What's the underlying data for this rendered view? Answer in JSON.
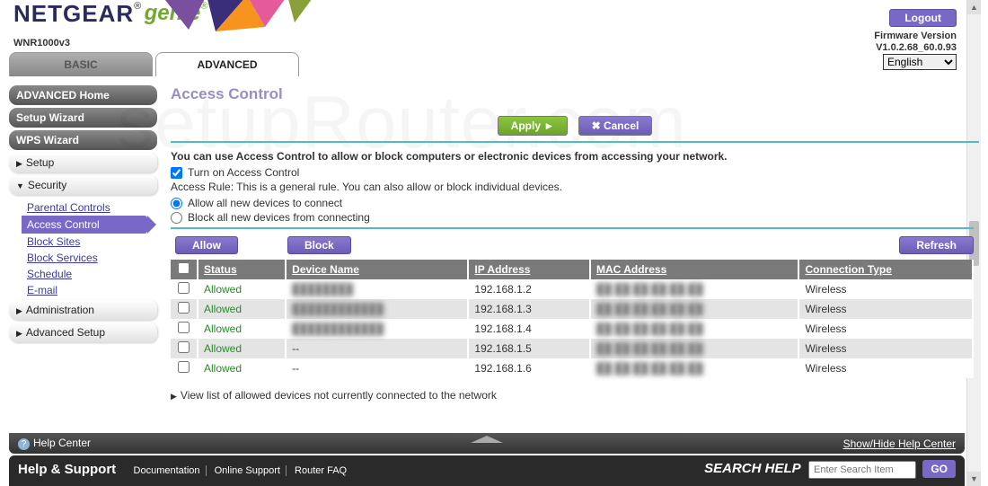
{
  "brand": {
    "netgear": "NETGEAR",
    "genie": "genie",
    "reg": "®"
  },
  "model": "WNR1000v3",
  "logout": "Logout",
  "firmware": {
    "label": "Firmware Version",
    "version": "V1.0.2.68_60.0.93"
  },
  "language": {
    "selected": "English"
  },
  "tabs": {
    "basic": "BASIC",
    "advanced": "ADVANCED"
  },
  "sidebar": {
    "home": "ADVANCED Home",
    "setup_wizard": "Setup Wizard",
    "wps_wizard": "WPS Wizard",
    "setup": "Setup",
    "security": "Security",
    "security_items": {
      "parental": "Parental Controls",
      "access_control": "Access Control",
      "block_sites": "Block Sites",
      "block_services": "Block Services",
      "schedule": "Schedule",
      "email": "E-mail"
    },
    "administration": "Administration",
    "advanced_setup": "Advanced Setup"
  },
  "page": {
    "title": "Access Control",
    "apply": "Apply ►",
    "cancel": "Cancel",
    "cancel_x": "✖",
    "intro": "You can use Access Control to allow or block computers or electronic devices from accessing your network.",
    "turn_on": "Turn on Access Control",
    "rule_text": "Access Rule: This is a general rule. You can also allow or block individual devices.",
    "radio_allow": "Allow all new devices to connect",
    "radio_block": "Block all new devices from connecting",
    "allow_btn": "Allow",
    "block_btn": "Block",
    "refresh_btn": "Refresh",
    "cols": {
      "status": "Status",
      "device": "Device Name",
      "ip": "IP Address",
      "mac": "MAC Address",
      "conn": "Connection Type"
    },
    "rows": [
      {
        "status": "Allowed",
        "device": "████████",
        "ip": "192.168.1.2",
        "mac": "██:██:██:██:██:██",
        "conn": "Wireless"
      },
      {
        "status": "Allowed",
        "device": "████████████",
        "ip": "192.168.1.3",
        "mac": "██:██:██:██:██:██",
        "conn": "Wireless"
      },
      {
        "status": "Allowed",
        "device": "████████████",
        "ip": "192.168.1.4",
        "mac": "██:██:██:██:██:██",
        "conn": "Wireless"
      },
      {
        "status": "Allowed",
        "device": "--",
        "ip": "192.168.1.5",
        "mac": "██:██:██:██:██:██",
        "conn": "Wireless"
      },
      {
        "status": "Allowed",
        "device": "--",
        "ip": "192.168.1.6",
        "mac": "██:██:██:██:██:██",
        "conn": "Wireless"
      }
    ],
    "viewlist": "View list of allowed devices not currently connected to the network"
  },
  "helpbar": {
    "center": "Help Center",
    "showhide": "Show/Hide Help Center"
  },
  "footer": {
    "help_support": "Help & Support",
    "links": {
      "doc": "Documentation",
      "online": "Online Support",
      "faq": "Router FAQ"
    },
    "search_label": "SEARCH HELP",
    "search_placeholder": "Enter Search Item",
    "go": "GO"
  },
  "watermark": "setupRouter.com"
}
